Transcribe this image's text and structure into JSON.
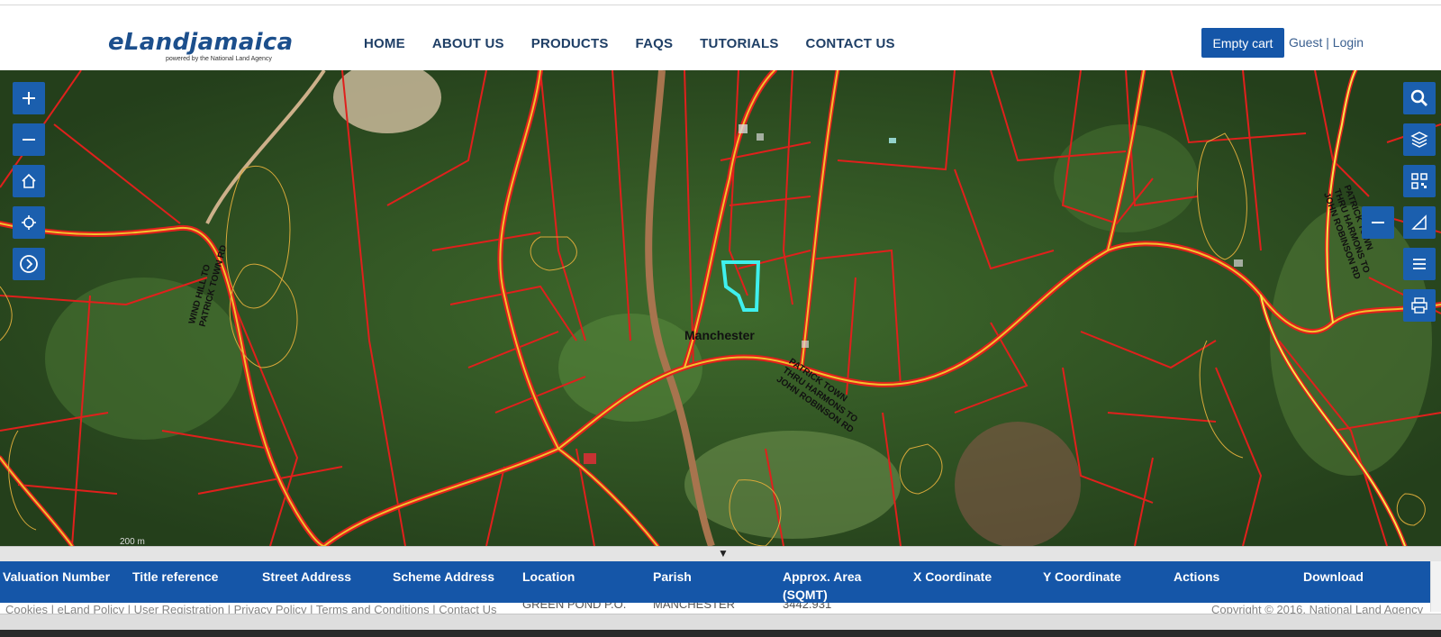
{
  "header": {
    "logo_text": "eLandjamaica",
    "logo_sub": "powered by the National Land Agency",
    "nav": [
      "HOME",
      "ABOUT US",
      "PRODUCTS",
      "FAQS",
      "TUTORIALS",
      "CONTACT US"
    ],
    "cart_button": "Empty cart",
    "guest": "Guest",
    "separator": "|",
    "login": "Login"
  },
  "map": {
    "place_label": "Manchester",
    "road_labels": {
      "patrick_town": [
        "PATRICK TOWN",
        "THRU HARMONS TO",
        "JOHN ROBINSON RD"
      ],
      "windhill": [
        "WIND HILL TO",
        "PATRICK TOWN RD"
      ],
      "east": [
        "PATRICK TOWN",
        "THRU HARMONS TO",
        "JOHN ROBINSON RD"
      ]
    },
    "scale_text": "200 m",
    "controls_left": [
      "zoom-in",
      "zoom-out",
      "home",
      "locate",
      "next"
    ],
    "controls_right": [
      "search",
      "layers",
      "qr-code",
      "measure",
      "list",
      "print"
    ],
    "colors": {
      "parcel": "#e0201c",
      "road": "#f2c12e",
      "selected": "#3ff0ee",
      "zone": "#d8a93a"
    }
  },
  "table": {
    "collapse_icon": "▼",
    "columns": [
      "Valuation Number",
      "Title reference",
      "Street Address",
      "Scheme Address",
      "Location",
      "Parish",
      "Approx. Area (SQMT)",
      "X Coordinate",
      "Y Coordinate",
      "Actions",
      "Download"
    ],
    "row_partial": {
      "location": "GREEN POND P.O.",
      "parish": "MANCHESTER",
      "area": "3442.931"
    }
  },
  "footer": {
    "links": "Cookies | eLand Policy | User Registration | Privacy Policy | Terms and Conditions | Contact Us",
    "copyright": "Copyright © 2016. National Land Agency"
  }
}
